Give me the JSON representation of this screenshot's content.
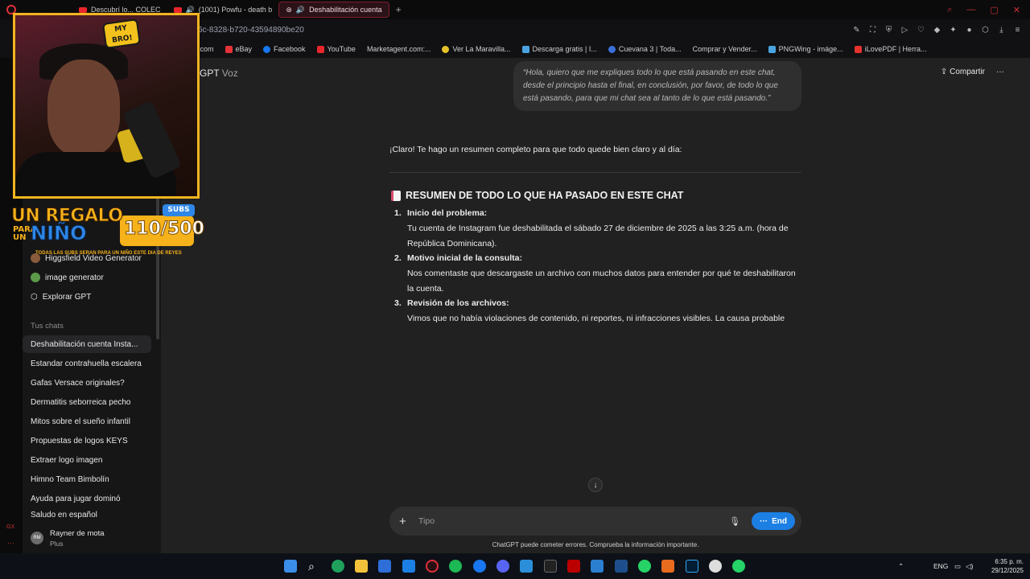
{
  "browser": {
    "tabs": [
      {
        "label": "Descubrí lo... COLEC",
        "type": "youtube"
      },
      {
        "label": "(1001) Powfu - death b",
        "type": "audio"
      },
      {
        "label": "Deshabilitación cuenta",
        "type": "chatgpt",
        "active": true
      }
    ],
    "url": "6c-8328-b720-43594890be20",
    "bookmarks": [
      ".com",
      "eBay",
      "Facebook",
      "YouTube",
      "Marketagent.com:...",
      "Ver La Maravilla...",
      "Descarga gratis | I...",
      "Cuevana 3 | Toda...",
      "Comprar y Vender...",
      "PNGWing - imáge...",
      "iLovePDF | Herra..."
    ]
  },
  "sidebar": {
    "tools": [
      {
        "label": "Higgsfield Video Generator"
      },
      {
        "label": "image generator"
      },
      {
        "label": "Explorar GPT"
      }
    ],
    "chats_heading": "Tus chats",
    "chats": [
      "Deshabilitación cuenta Insta...",
      "Estandar contrahuella escalera",
      "Gafas Versace originales?",
      "Dermatitis seborreica pecho",
      "Mitos sobre el sueño infantil",
      "Propuestas de logos KEYS",
      "Extraer logo imagen",
      "Himno Team Bimbolín",
      "Ayuda para jugar dominó",
      "Saludo en español"
    ],
    "user": {
      "initials": "RM",
      "name": "Rayner de mota",
      "plan": "Plus"
    }
  },
  "header": {
    "title": "GPT",
    "subtitle": "Voz",
    "share": "Compartir",
    "more": "···"
  },
  "conversation": {
    "user_message": "“Hola, quiero que me expliques todo lo que está pasando en este chat, desde el principio hasta el final, en conclusión, por favor, de todo lo que está pasando, para que mi chat sea al tanto de lo que está pasando.”",
    "intro": "¡Claro! Te hago un resumen completo para que todo quede bien claro y al día:",
    "heading": "RESUMEN DE TODO LO QUE HA PASADO EN ESTE CHAT",
    "items": [
      {
        "num": "1.",
        "title": "Inicio del problema:",
        "body": "Tu cuenta de Instagram fue deshabilitada el sábado 27 de diciembre de 2025 a las 3:25 a.m. (hora de República Dominicana)."
      },
      {
        "num": "2.",
        "title": "Motivo inicial de la consulta:",
        "body": "Nos comentaste que descargaste un archivo con muchos datos para entender por qué te deshabilitaron la cuenta."
      },
      {
        "num": "3.",
        "title": "Revisión de los archivos:",
        "body": "Vimos que no había violaciones de contenido, ni reportes, ni infracciones visibles. La causa probable"
      }
    ]
  },
  "composer": {
    "placeholder": "Tipo",
    "end_label": "End",
    "disclaimer": "ChatGPT puede cometer errores. Comprueba la información importante."
  },
  "overlay": {
    "badge": "MY BRO!",
    "line1": "UN REGALO",
    "para": "PARA",
    "un": "UN",
    "nino": "NIÑO",
    "subs_tag": "SUBS",
    "subs_count": "110/500",
    "small": "TODAS LAS SUBS SERAN PARA UN NIÑO ESTE DIA DE REYES"
  },
  "taskbar": {
    "lang": "ENG",
    "time": "6:35 p. m.",
    "date": "29/12/2025"
  }
}
